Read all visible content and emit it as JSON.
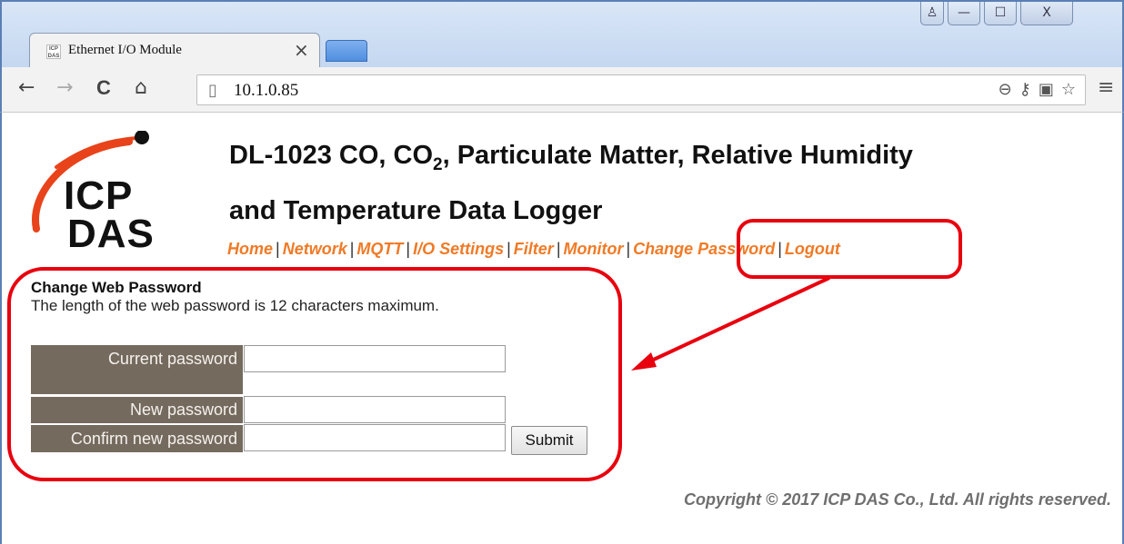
{
  "browser": {
    "tab_title": "Ethernet I/O Module",
    "tab_close": "×",
    "url": "10.1.0.85",
    "favicon_text": "ICP DAS"
  },
  "icons": {
    "back": "←",
    "forward": "→",
    "reload": "C",
    "home": "⌂",
    "page": "▯",
    "zoom": "⊖",
    "key": "⚷",
    "translate": "▣",
    "star": "☆",
    "menu": "≡",
    "minimize": "—",
    "maximize": "☐",
    "close": "X",
    "user": "♙"
  },
  "logo": {
    "line1": "ICP",
    "line2": "DAS"
  },
  "header": {
    "title_part1": "DL-1023 CO, CO",
    "title_sub": "2",
    "title_part2": ", Particulate Matter, Relative Humidity",
    "title_line2": "and Temperature Data Logger"
  },
  "nav": {
    "items": [
      "Home",
      "Network",
      "MQTT",
      "I/O Settings",
      "Filter",
      "Monitor",
      "Change Password",
      "Logout"
    ],
    "separator": "|"
  },
  "form": {
    "title": "Change Web Password",
    "description": "The length of the web password is 12 characters maximum.",
    "current_label": "Current password",
    "new_label": "New password",
    "confirm_label": "Confirm new password",
    "current_value": "",
    "new_value": "",
    "confirm_value": "",
    "submit_label": "Submit"
  },
  "footer": {
    "copyright": "Copyright © 2017 ICP DAS Co., Ltd. All rights reserved."
  },
  "colors": {
    "nav_link": "#f07a26",
    "label_bg": "#756a5e",
    "annotation": "#e8000e"
  }
}
